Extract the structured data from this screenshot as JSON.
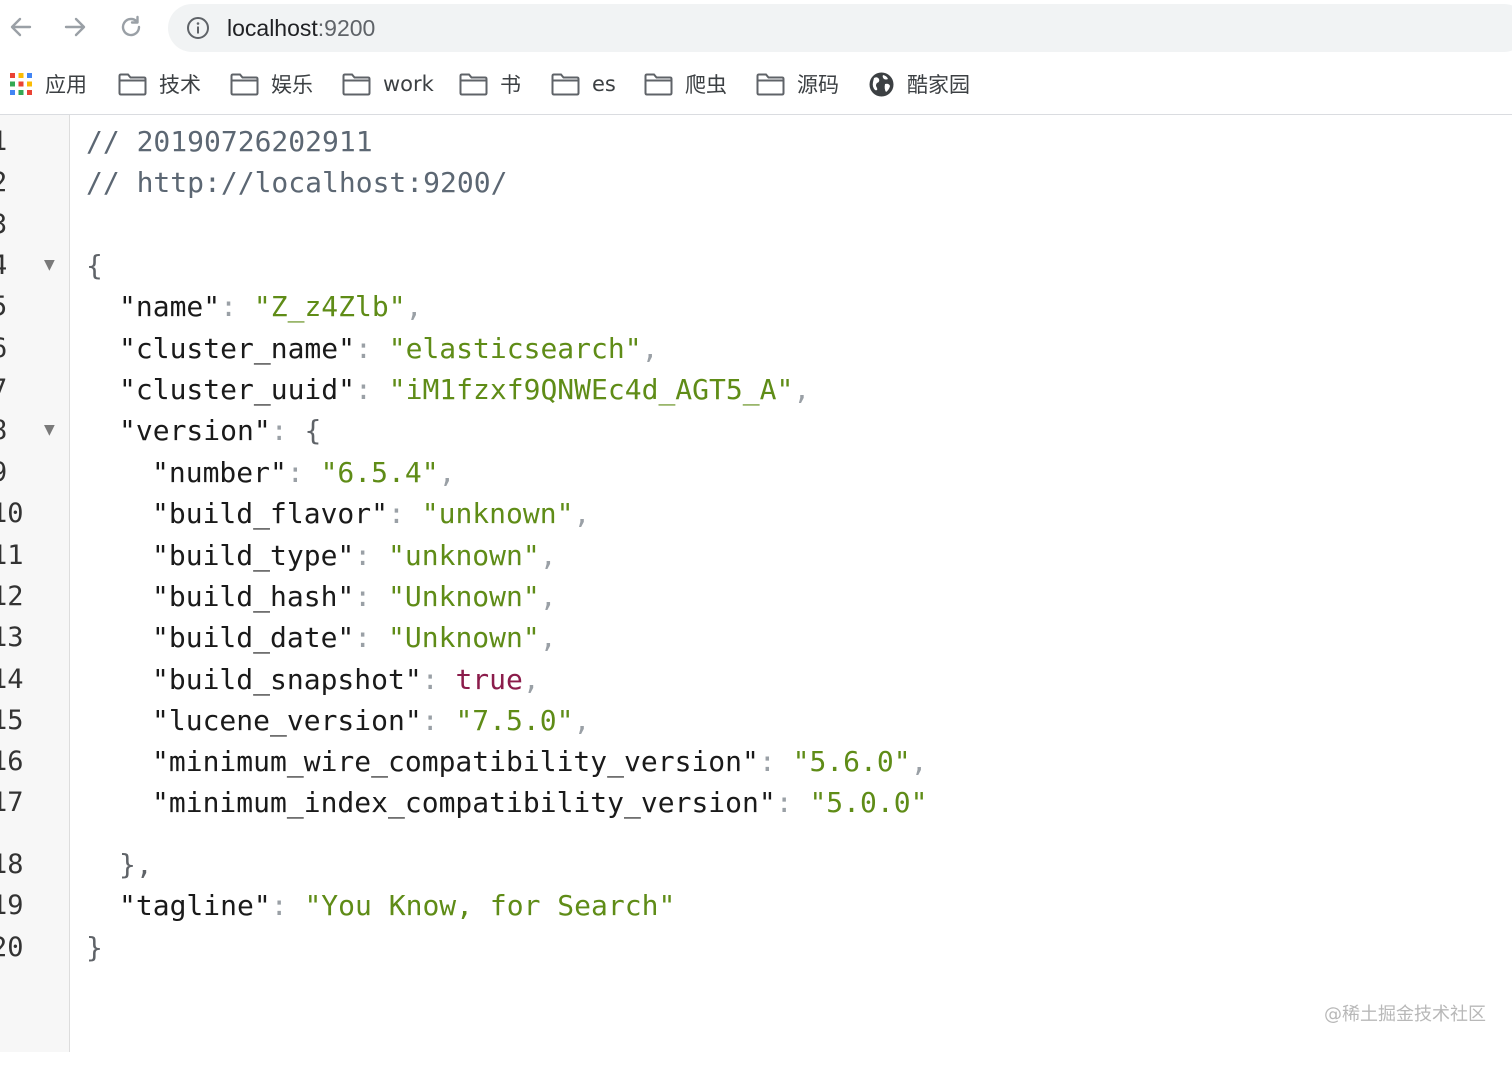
{
  "browser": {
    "url_host": "localhost",
    "url_port": ":9200"
  },
  "bookmarks": [
    {
      "label": "应用",
      "icon": "apps-grid-icon"
    },
    {
      "label": "技术",
      "icon": "folder-icon"
    },
    {
      "label": "娱乐",
      "icon": "folder-icon"
    },
    {
      "label": "work",
      "icon": "folder-icon"
    },
    {
      "label": "书",
      "icon": "folder-icon"
    },
    {
      "label": "es",
      "icon": "folder-icon"
    },
    {
      "label": "爬虫",
      "icon": "folder-icon"
    },
    {
      "label": "源码",
      "icon": "folder-icon"
    },
    {
      "label": "酷家园",
      "icon": "globe-icon"
    }
  ],
  "code": {
    "line_numbers": [
      "1",
      "2",
      "3",
      "4",
      "5",
      "6",
      "7",
      "8",
      "9",
      "10",
      "11",
      "12",
      "13",
      "14",
      "15",
      "16",
      "17",
      "18",
      "19",
      "20"
    ],
    "comment_timestamp": "// 20190726202911",
    "comment_url": "// http://localhost:9200/",
    "open_brace": "{",
    "close_brace": "}",
    "name": {
      "key": "\"name\"",
      "value": "\"Z_z4Zlb\""
    },
    "cluster_name": {
      "key": "\"cluster_name\"",
      "value": "\"elasticsearch\""
    },
    "cluster_uuid": {
      "key": "\"cluster_uuid\"",
      "value": "\"iM1fzxf9QNWEc4d_AGT5_A\""
    },
    "version_key": "\"version\"",
    "version_close": "},",
    "version": [
      {
        "key": "\"number\"",
        "value": "\"6.5.4\"",
        "type": "str",
        "comma": ","
      },
      {
        "key": "\"build_flavor\"",
        "value": "\"unknown\"",
        "type": "str",
        "comma": ","
      },
      {
        "key": "\"build_type\"",
        "value": "\"unknown\"",
        "type": "str",
        "comma": ","
      },
      {
        "key": "\"build_hash\"",
        "value": "\"Unknown\"",
        "type": "str",
        "comma": ","
      },
      {
        "key": "\"build_date\"",
        "value": "\"Unknown\"",
        "type": "str",
        "comma": ","
      },
      {
        "key": "\"build_snapshot\"",
        "value": "true",
        "type": "bool",
        "comma": ","
      },
      {
        "key": "\"lucene_version\"",
        "value": "\"7.5.0\"",
        "type": "str",
        "comma": ","
      },
      {
        "key": "\"minimum_wire_compatibility_version\"",
        "value": "\"5.6.0\"",
        "type": "str",
        "comma": ","
      },
      {
        "key": "\"minimum_index_compatibility_version\"",
        "value": "\"5.0.0\"",
        "type": "str",
        "comma": ""
      }
    ],
    "tagline": {
      "key": "\"tagline\"",
      "value": "\"You Know, for Search\""
    }
  },
  "watermark": "@稀土掘金技术社区",
  "colors": {
    "string": "#5f8c17",
    "boolean": "#8b1c4b",
    "comment": "#5c6773"
  }
}
